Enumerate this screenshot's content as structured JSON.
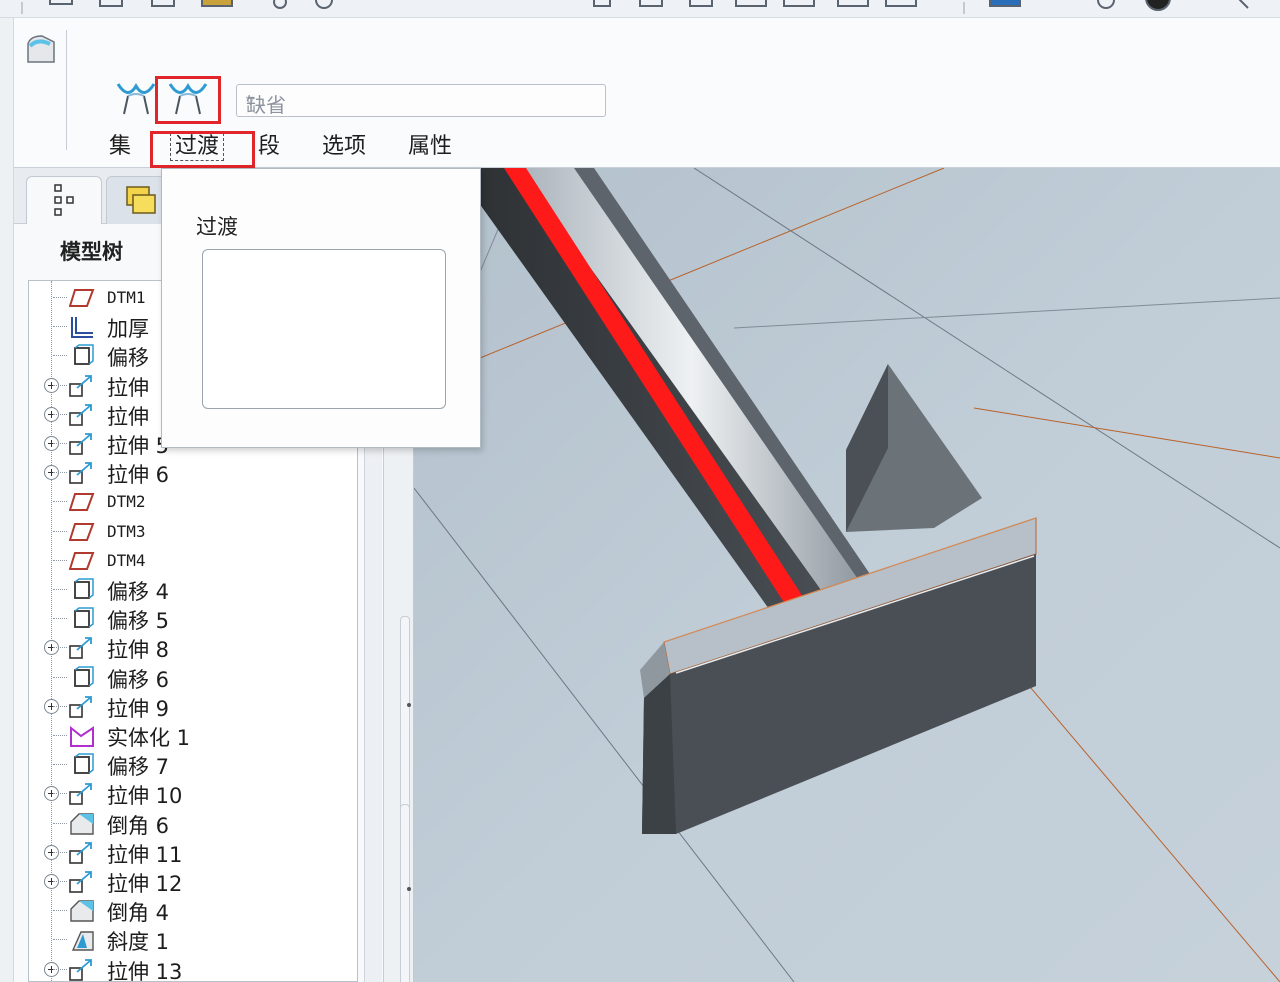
{
  "colors": {
    "highlight": "#e0262a",
    "edge_highlight": "#ff1a1a",
    "datum_edge": "#b8612a",
    "solid": "#4a4f55"
  },
  "toolbar": {
    "icons": [
      "menu-icon",
      "new-icon",
      "open-icon",
      "save-icon",
      "print-icon",
      "regenerate-icon"
    ]
  },
  "dashboard": {
    "defaults_select": {
      "value": "缺省"
    },
    "tabs": [
      {
        "label": "集"
      },
      {
        "label": "过渡"
      },
      {
        "label": "段"
      },
      {
        "label": "选项"
      },
      {
        "label": "属性"
      }
    ]
  },
  "model_tree": {
    "title": "模型树",
    "items": [
      {
        "label": "DTM1",
        "icon": "datum-plane-icon",
        "expandable": false
      },
      {
        "label": "加厚",
        "icon": "thicken-icon",
        "expandable": false
      },
      {
        "label": "偏移",
        "icon": "offset-icon",
        "expandable": false
      },
      {
        "label": "拉伸",
        "icon": "extrude-icon",
        "expandable": true
      },
      {
        "label": "拉伸",
        "icon": "extrude-icon",
        "expandable": true
      },
      {
        "label": "拉伸 5",
        "icon": "extrude-icon",
        "expandable": true
      },
      {
        "label": "拉伸 6",
        "icon": "extrude-icon",
        "expandable": true
      },
      {
        "label": "DTM2",
        "icon": "datum-plane-icon",
        "expandable": false
      },
      {
        "label": "DTM3",
        "icon": "datum-plane-icon",
        "expandable": false
      },
      {
        "label": "DTM4",
        "icon": "datum-plane-icon",
        "expandable": false
      },
      {
        "label": "偏移 4",
        "icon": "offset-icon",
        "expandable": false
      },
      {
        "label": "偏移 5",
        "icon": "offset-icon",
        "expandable": false
      },
      {
        "label": "拉伸 8",
        "icon": "extrude-icon",
        "expandable": true
      },
      {
        "label": "偏移 6",
        "icon": "offset-icon",
        "expandable": false
      },
      {
        "label": "拉伸 9",
        "icon": "extrude-icon",
        "expandable": true
      },
      {
        "label": "实体化 1",
        "icon": "solidify-icon",
        "expandable": false
      },
      {
        "label": "偏移 7",
        "icon": "offset-icon",
        "expandable": false
      },
      {
        "label": "拉伸 10",
        "icon": "extrude-icon",
        "expandable": true
      },
      {
        "label": "倒角 6",
        "icon": "chamfer-icon",
        "expandable": false
      },
      {
        "label": "拉伸 11",
        "icon": "extrude-icon",
        "expandable": true
      },
      {
        "label": "拉伸 12",
        "icon": "extrude-icon",
        "expandable": true
      },
      {
        "label": "倒角 4",
        "icon": "chamfer-icon",
        "expandable": false
      },
      {
        "label": "斜度 1",
        "icon": "draft-icon",
        "expandable": false
      },
      {
        "label": "拉伸 13",
        "icon": "extrude-icon",
        "expandable": true
      }
    ]
  },
  "transition_popup": {
    "title": "过渡"
  }
}
